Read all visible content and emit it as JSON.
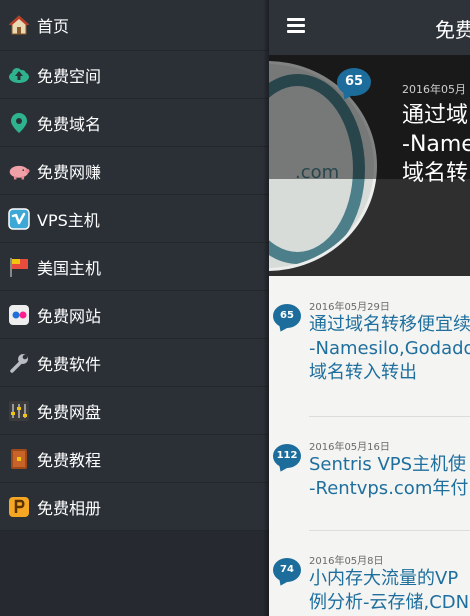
{
  "sidebar": {
    "items": [
      {
        "label": "首页",
        "icon": "home-icon"
      },
      {
        "label": "免费空间",
        "icon": "cloud-upload-icon"
      },
      {
        "label": "免费域名",
        "icon": "map-pin-icon"
      },
      {
        "label": "免费网赚",
        "icon": "piggy-bank-icon"
      },
      {
        "label": "VPS主机",
        "icon": "vimeo-icon"
      },
      {
        "label": "美国主机",
        "icon": "flag-icon"
      },
      {
        "label": "免费网站",
        "icon": "flickr-icon"
      },
      {
        "label": "免费软件",
        "icon": "wrench-icon"
      },
      {
        "label": "免费网盘",
        "icon": "equalizer-icon"
      },
      {
        "label": "免费教程",
        "icon": "book-icon"
      },
      {
        "label": "免费相册",
        "icon": "picture-icon"
      }
    ]
  },
  "header": {
    "title": "免费",
    "menu_icon": "hamburger-menu-icon"
  },
  "hero": {
    "comments": "65",
    "date": "2016年05月",
    "title": "通过域\n-Name\n域名转",
    "image_text": ".com"
  },
  "articles": [
    {
      "comments": "65",
      "date": "2016年05月29日",
      "title": "通过域名转移便宜续\n-Namesilo,Godaddy\n域名转入转出"
    },
    {
      "comments": "112",
      "date": "2016年05月16日",
      "title": "Sentris VPS主机使\n-Rentvps.com年付"
    },
    {
      "comments": "74",
      "date": "2016年05月8日",
      "title": "小内存大流量的VP\n例分析-云存储,CDN"
    }
  ],
  "colors": {
    "sidebar": "#2b3037",
    "topbar": "#2e333a",
    "accent": "#1c6d9c",
    "link": "#1f6f9e"
  }
}
